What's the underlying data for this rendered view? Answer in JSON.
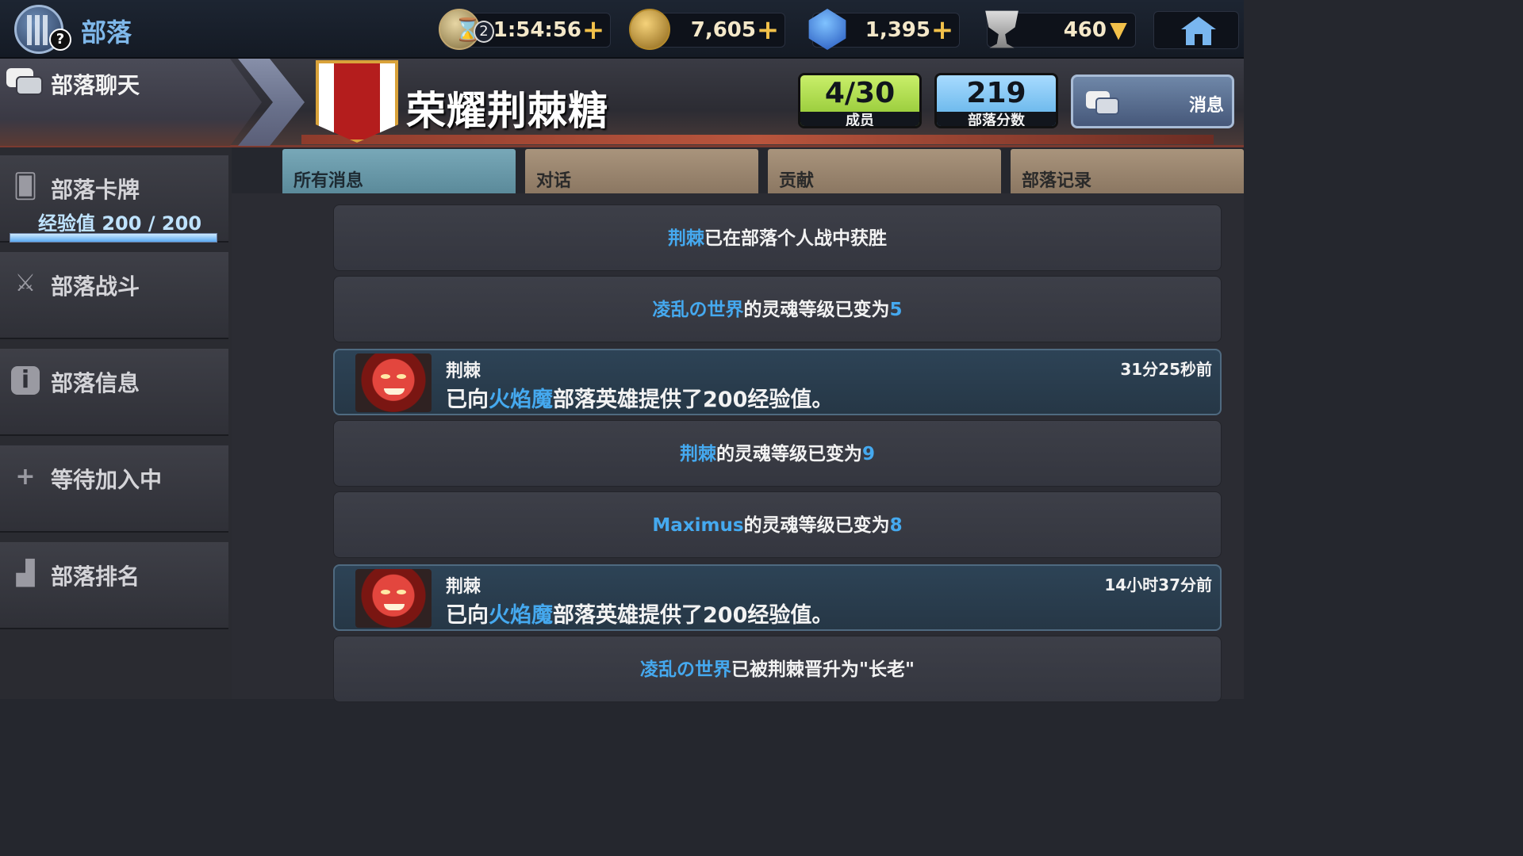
{
  "topbar": {
    "title": "部落",
    "help": "?",
    "timer": {
      "count": "2",
      "value": "1:54:56",
      "plus": "+"
    },
    "gold": {
      "value": "7,605",
      "plus": "+"
    },
    "gems": {
      "value": "1,395",
      "plus": "+"
    },
    "trophy": {
      "value": "460",
      "arrow": "▼"
    },
    "home_icon": "home-icon"
  },
  "chat_tab": {
    "label": "部落聊天"
  },
  "clan": {
    "name": "荣耀荆棘糖",
    "members": {
      "value": "4/30",
      "caption": "成员"
    },
    "score": {
      "value": "219",
      "caption": "部落分数"
    },
    "messages_label": "消息"
  },
  "sidebar": {
    "cards": {
      "label": "部落卡牌",
      "xp_label": "经验值 200 / 200",
      "xp_fraction": 1.0
    },
    "battle": {
      "label": "部落战斗"
    },
    "info": {
      "label": "部落信息",
      "icon": "i"
    },
    "pending": {
      "label": "等待加入中",
      "icon": "+"
    },
    "ranking": {
      "label": "部落排名"
    }
  },
  "tabs": {
    "all": "所有消息",
    "dialog": "对话",
    "contrib": "贡献",
    "log": "部落记录"
  },
  "messages": {
    "m1": {
      "name": "荆棘",
      "text": "已在部落个人战中获胜"
    },
    "m2": {
      "name": "凌乱の世界",
      "text": "的灵魂等级已变为",
      "value": "5"
    },
    "m3": {
      "player": "荆棘",
      "time": "31分25秒前",
      "pre": "已向",
      "hero": "火焰魔",
      "post": "部落英雄提供了200经验值。"
    },
    "m4": {
      "name": "荆棘",
      "text": "的灵魂等级已变为",
      "value": "9"
    },
    "m5": {
      "name": "Maximus",
      "text": "的灵魂等级已变为",
      "value": "8"
    },
    "m6": {
      "player": "荆棘",
      "time": "14小时37分前",
      "pre": "已向",
      "hero": "火焰魔",
      "post": "部落英雄提供了200经验值。"
    },
    "m7": {
      "name": "凌乱の世界",
      "text": "已被荆棘晋升为\"长老\""
    }
  }
}
